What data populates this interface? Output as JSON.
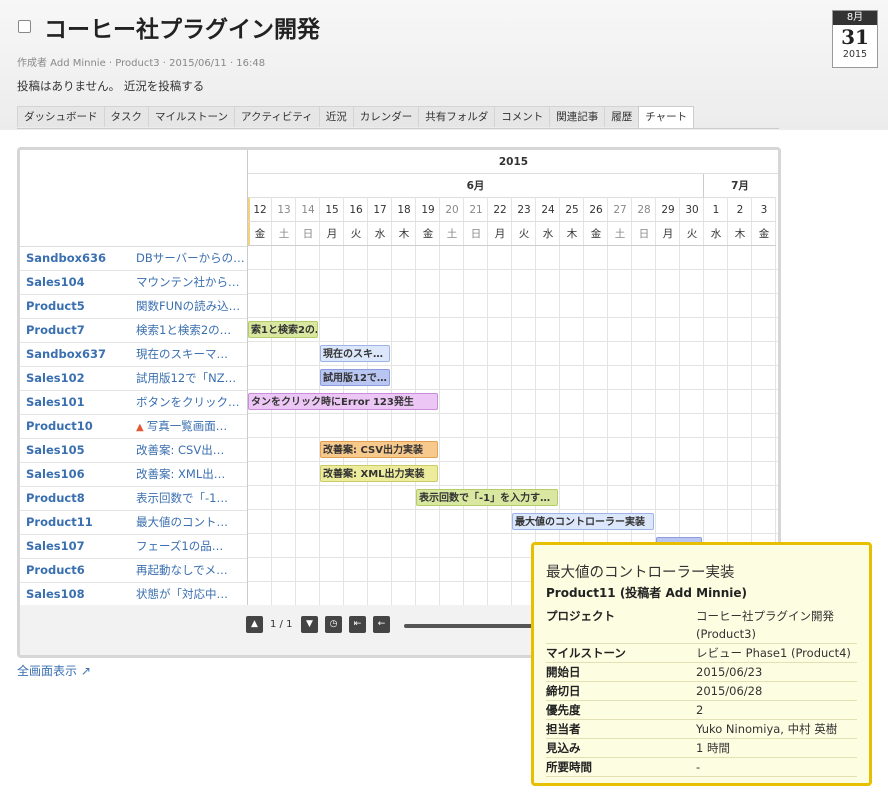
{
  "page": {
    "title": "コーヒー社プラグイン開発",
    "meta": "作成者 Add Minnie · Product3 · 2015/06/11 · 16:48",
    "status_text": "投稿はありません。",
    "status_link": "近況を投稿する",
    "full_screen_link": "全画面表示"
  },
  "calendar": {
    "month": "8月",
    "day": "31",
    "year": "2015"
  },
  "tabs": [
    {
      "label": "ダッシュボード"
    },
    {
      "label": "タスク"
    },
    {
      "label": "マイルストーン"
    },
    {
      "label": "アクティビティ"
    },
    {
      "label": "近況"
    },
    {
      "label": "カレンダー"
    },
    {
      "label": "共有フォルダ"
    },
    {
      "label": "コメント"
    },
    {
      "label": "関連記事"
    },
    {
      "label": "履歴"
    },
    {
      "label": "チャート"
    }
  ],
  "active_tab": "チャート",
  "gantt": {
    "year": "2015",
    "months": [
      "6月",
      "7月"
    ],
    "days": [
      {
        "d": "12",
        "w": "金"
      },
      {
        "d": "13",
        "w": "土"
      },
      {
        "d": "14",
        "w": "日"
      },
      {
        "d": "15",
        "w": "月"
      },
      {
        "d": "16",
        "w": "火"
      },
      {
        "d": "17",
        "w": "水"
      },
      {
        "d": "18",
        "w": "木"
      },
      {
        "d": "19",
        "w": "金"
      },
      {
        "d": "20",
        "w": "土"
      },
      {
        "d": "21",
        "w": "日"
      },
      {
        "d": "22",
        "w": "月"
      },
      {
        "d": "23",
        "w": "火"
      },
      {
        "d": "24",
        "w": "水"
      },
      {
        "d": "25",
        "w": "木"
      },
      {
        "d": "26",
        "w": "金"
      },
      {
        "d": "27",
        "w": "土"
      },
      {
        "d": "28",
        "w": "日"
      },
      {
        "d": "29",
        "w": "月"
      },
      {
        "d": "30",
        "w": "火"
      },
      {
        "d": "1",
        "w": "水"
      },
      {
        "d": "2",
        "w": "木"
      },
      {
        "d": "3",
        "w": "金"
      }
    ],
    "rows": [
      {
        "key": "Sandbox636",
        "summary": "DBサーバーからの…",
        "warn": false
      },
      {
        "key": "Sales104",
        "summary": "マウンテン社から…",
        "warn": false
      },
      {
        "key": "Product5",
        "summary": "関数FUNの読み込…",
        "warn": false
      },
      {
        "key": "Product7",
        "summary": "検索1と検索2の…",
        "warn": false,
        "bar": {
          "label": "索1と検索2の…",
          "start": "2015-06-12",
          "end": "2015-06-14",
          "color": "#d9e8a0",
          "border": "#b4cc6a"
        }
      },
      {
        "key": "Sandbox637",
        "summary": "現在のスキーマ…",
        "warn": false,
        "bar": {
          "label": "現在のスキ…",
          "start": "2015-06-15",
          "end": "2015-06-17",
          "color": "#dde7fb",
          "border": "#9db4e4"
        }
      },
      {
        "key": "Sales102",
        "summary": "試用版12で「NZ…",
        "warn": false,
        "bar": {
          "label": "試用版12で…",
          "start": "2015-06-15",
          "end": "2015-06-17",
          "color": "#b9c6f2",
          "border": "#8c9cdc"
        }
      },
      {
        "key": "Sales101",
        "summary": "ボタンをクリック…",
        "warn": false,
        "bar": {
          "label": "タンをクリック時にError 123発生",
          "start": "2015-06-12",
          "end": "2015-06-19",
          "color": "#ecc6f5",
          "border": "#c98dd9"
        }
      },
      {
        "key": "Product10",
        "summary": "写真一覧画面…",
        "warn": true
      },
      {
        "key": "Sales105",
        "summary": "改善案: CSV出…",
        "warn": false,
        "bar": {
          "label": "改善案: CSV出力実装",
          "start": "2015-06-15",
          "end": "2015-06-19",
          "color": "#f8c98d",
          "border": "#e2a050"
        }
      },
      {
        "key": "Sales106",
        "summary": "改善案: XML出…",
        "warn": false,
        "bar": {
          "label": "改善案: XML出力実装",
          "start": "2015-06-15",
          "end": "2015-06-19",
          "color": "#ecec9c",
          "border": "#cccc66"
        }
      },
      {
        "key": "Product8",
        "summary": "表示回数で「-1…",
        "warn": false,
        "bar": {
          "label": "表示回数で「-1」を入力す…",
          "start": "2015-06-19",
          "end": "2015-06-24",
          "color": "#d9e8a0",
          "border": "#b4cc6a"
        }
      },
      {
        "key": "Product11",
        "summary": "最大値のコント…",
        "warn": false,
        "bar": {
          "label": "最大値のコントローラー実装",
          "start": "2015-06-23",
          "end": "2015-06-28",
          "color": "#dde7fb",
          "border": "#9db4e4"
        }
      },
      {
        "key": "Sales107",
        "summary": "フェーズ1の品…",
        "warn": false,
        "bar": {
          "label": "",
          "start": "2015-06-29",
          "end": "2015-06-30",
          "color": "#b9c6f2",
          "border": "#8c9cdc"
        }
      },
      {
        "key": "Product6",
        "summary": "再起動なしでメ…",
        "warn": false
      },
      {
        "key": "Sales108",
        "summary": "状態が「対応中…",
        "warn": false
      }
    ]
  },
  "pager": {
    "page_text": "1 / 1"
  },
  "tooltip": {
    "title": "最大値のコントローラー実装",
    "subtitle": "Product11 (投稿者 Add Minnie)",
    "fields": [
      {
        "label": "プロジェクト",
        "value": "コーヒー社プラグイン開発 (Product3)"
      },
      {
        "label": "マイルストーン",
        "value": "レビュー Phase1 (Product4)"
      },
      {
        "label": "開始日",
        "value": "2015/06/23"
      },
      {
        "label": "締切日",
        "value": "2015/06/28"
      },
      {
        "label": "優先度",
        "value": "2"
      },
      {
        "label": "担当者",
        "value": "Yuko Ninomiya, 中村 英樹"
      },
      {
        "label": "見込み",
        "value": "1 時間"
      },
      {
        "label": "所要時間",
        "value": "-"
      }
    ]
  }
}
